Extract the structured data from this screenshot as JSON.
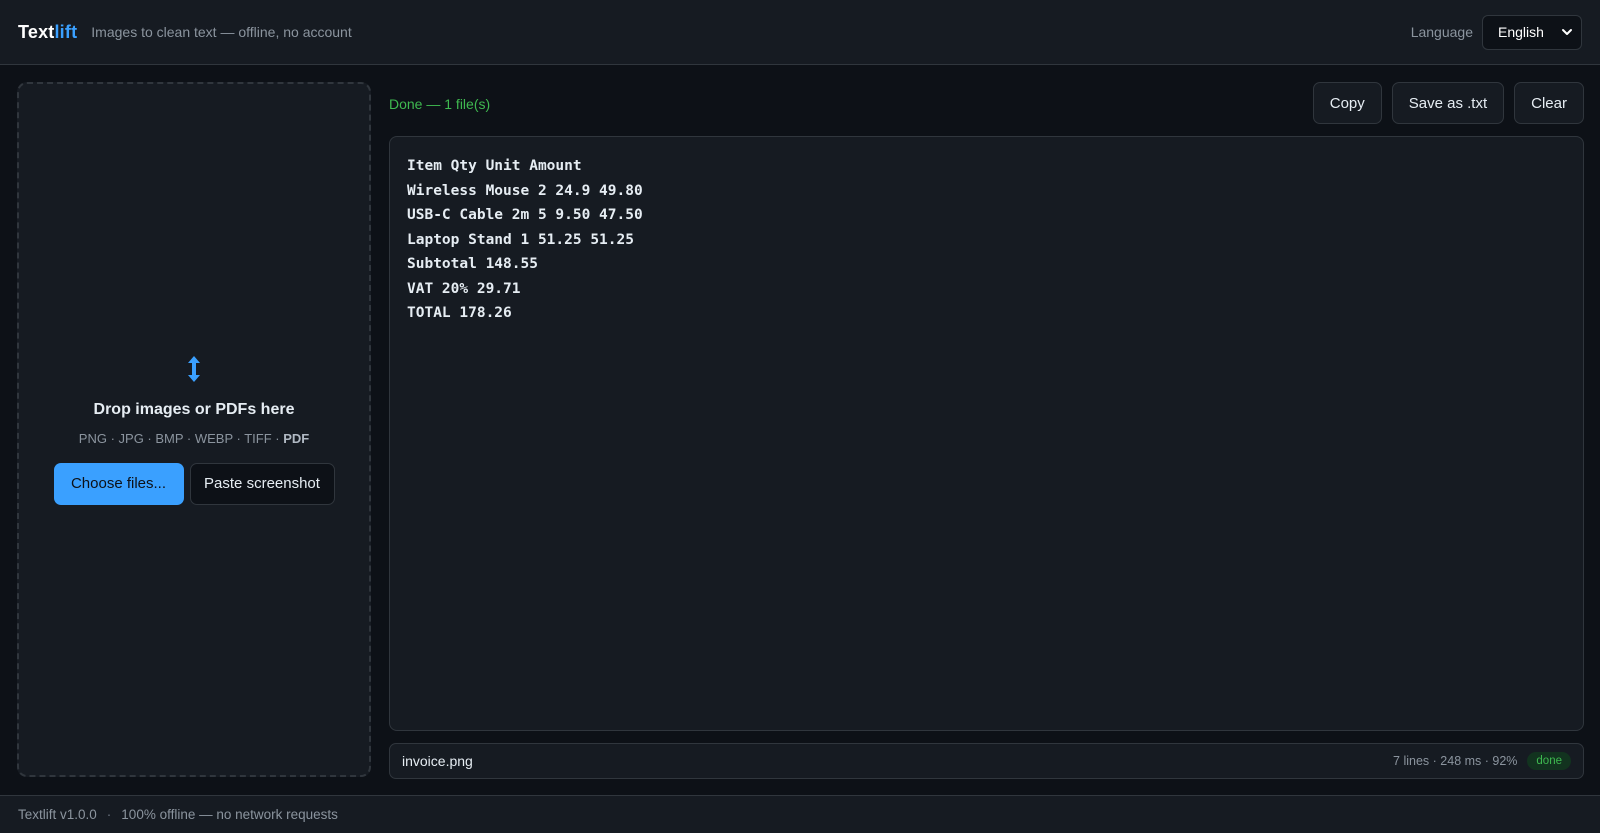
{
  "header": {
    "brand_main": "Text",
    "brand_accent": "lift",
    "tagline": "Images to clean text — offline, no account",
    "language_label": "Language",
    "language_value": "English"
  },
  "dropzone": {
    "icon": "vertical-arrows-icon",
    "title": "Drop images or PDFs here",
    "formats": "PNG · JPG · BMP · WEBP · TIFF · ",
    "formats_bold": "PDF",
    "choose_label": "Choose files...",
    "paste_label": "Paste screenshot"
  },
  "toolbar": {
    "status": "Done — 1 file(s)",
    "copy_label": "Copy",
    "save_label": "Save as .txt",
    "clear_label": "Clear"
  },
  "output": {
    "lines": [
      "Item Qty Unit Amount",
      "Wireless Mouse 2 24.9 49.80",
      "USB-C Cable 2m 5 9.50 47.50",
      "Laptop Stand 1 51.25 51.25",
      "Subtotal 148.55",
      "VAT 20% 29.71",
      "TOTAL 178.26"
    ]
  },
  "file": {
    "name": "invoice.png",
    "meta": "7 lines · 248 ms · 92%",
    "status": "done"
  },
  "footer": {
    "version": "Textlift v1.0.0",
    "sep": "·",
    "note": "100% offline — no network requests"
  },
  "colors": {
    "accent": "#3aa0ff",
    "success": "#3fb950",
    "background": "#0d1117",
    "panel": "#161b22"
  }
}
